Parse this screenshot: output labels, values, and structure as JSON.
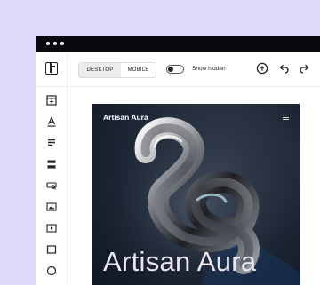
{
  "editor": {
    "device_options": [
      {
        "label": "Desktop",
        "active": true
      },
      {
        "label": "Mobile",
        "active": false
      }
    ],
    "show_hidden_label": "Show hidden",
    "show_hidden_enabled": false,
    "toolbar_icons": [
      "help-icon",
      "undo-icon",
      "redo-icon"
    ],
    "sidebar_icons": [
      "section-add-icon",
      "text-icon",
      "paragraph-icon",
      "list-icon",
      "search-field-icon",
      "image-icon",
      "video-icon",
      "box-icon",
      "circle-icon"
    ]
  },
  "hero": {
    "brand": "Artisan Aura",
    "title": "Artisan Aura"
  },
  "colors": {
    "backdrop": "#ddd9fb",
    "titlebar": "#08090f",
    "hero_bg": "#1c2634",
    "hero_title": "#ece6f3"
  }
}
